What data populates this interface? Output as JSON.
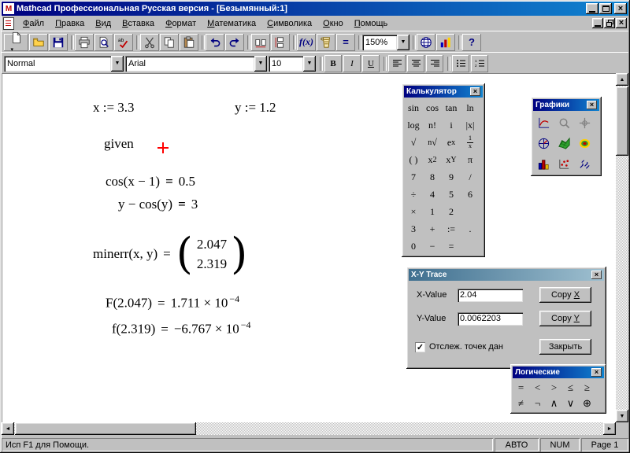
{
  "window": {
    "title": "Mathcad Профессиональная Русская версия - [Безымянный:1]"
  },
  "menu": {
    "items": [
      "Файл",
      "Правка",
      "Вид",
      "Вставка",
      "Формат",
      "Математика",
      "Символика",
      "Окно",
      "Помощь"
    ]
  },
  "toolbar": {
    "zoom": "150%",
    "buttons": [
      "new",
      "open",
      "save",
      "|",
      "print",
      "print-preview",
      "spell-check",
      "|",
      "cut",
      "copy",
      "paste",
      "|",
      "undo",
      "redo",
      "|",
      "align-across",
      "align-down",
      "|",
      "insert-function",
      "insert-unit",
      "calculate",
      "|",
      "zoom",
      "|",
      "insert-hyperlink",
      "insert-component",
      "|",
      "help"
    ]
  },
  "formatbar": {
    "style": "Normal",
    "font": "Arial",
    "size": "10",
    "bold": "B",
    "italic": "I",
    "underline": "U"
  },
  "document": {
    "regions": {
      "assign_x": "x := 3.3",
      "assign_y": "y := 1.2",
      "given": "given",
      "constraint1": {
        "lhs": "cos(x − 1)",
        "eq": "=",
        "rhs": "0.5"
      },
      "constraint2": {
        "lhs": "y − cos(y)",
        "eq": "=",
        "rhs": "3"
      },
      "minerr": {
        "lhs": "minerr(x, y)",
        "eq": "=",
        "vector": [
          "2.047",
          "2.319"
        ]
      },
      "check1": {
        "lhs": "F(2.047)",
        "eq": "=",
        "base": "1.711 × 10",
        "exp": "−4"
      },
      "check2": {
        "lhs": "f(2.319)",
        "eq": "=",
        "base": "−6.767 × 10",
        "exp": "−4"
      }
    }
  },
  "palettes": {
    "calculator": {
      "title": "Калькулятор",
      "rows": [
        [
          "sin",
          "cos",
          "tan",
          "ln"
        ],
        [
          "log",
          "n!",
          "i",
          "|x|"
        ],
        [
          "√",
          "n√",
          "e^x",
          "1/x"
        ],
        [
          "( )",
          "x^2",
          "x^Y",
          "π"
        ],
        [
          "7",
          "8",
          "9",
          "/"
        ],
        [
          "÷",
          "4",
          "5",
          "6"
        ],
        [
          "×",
          "1",
          "2"
        ],
        [
          "3",
          "+",
          ":=",
          "."
        ],
        [
          "0",
          "−",
          "="
        ]
      ]
    },
    "graphs": {
      "title": "Графики",
      "icons": [
        "xy-plot",
        "zoom-graph",
        "trace-graph",
        "polar-plot",
        "surface-plot",
        "contour-plot",
        "3d-bar-plot",
        "3d-scatter-plot",
        "vector-field-plot"
      ]
    },
    "boolean": {
      "title": "Логические",
      "rows": [
        [
          "=",
          "<",
          ">",
          "≤",
          "≥"
        ],
        [
          "≠",
          "¬",
          "∧",
          "∨",
          "⊕"
        ]
      ]
    }
  },
  "trace_dialog": {
    "title": "X-Y Trace",
    "x_label": "X-Value",
    "x_value": "2.04",
    "copy_x": "Copy X",
    "y_label": "Y-Value",
    "y_value": "0.0062203",
    "copy_y": "Copy Y",
    "track_label": "Отслеж. точек дан",
    "track_checked": true,
    "close_label": "Закрыть"
  },
  "statusbar": {
    "help": "Исп F1 для Помощи.",
    "auto": "АВТО",
    "num": "NUM",
    "page": "Page 1"
  }
}
